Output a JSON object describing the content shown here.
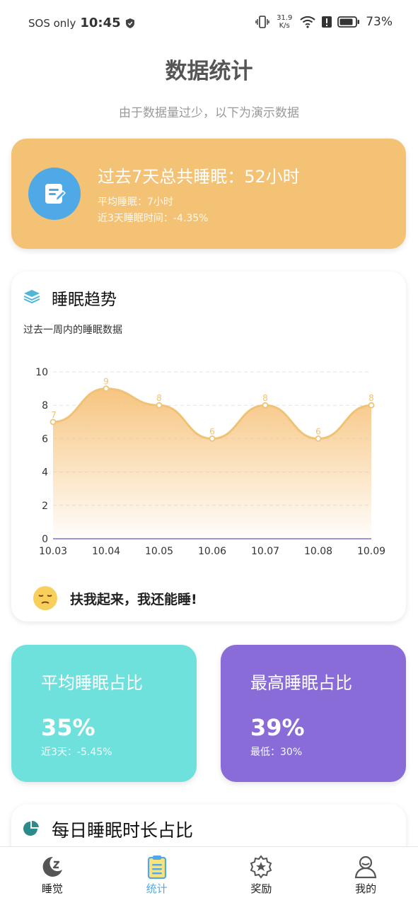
{
  "status_bar": {
    "carrier": "SOS only",
    "time": "10:45",
    "net_speed_value": "31.9",
    "net_speed_unit": "K/s",
    "battery": "73%"
  },
  "header": {
    "title": "数据统计",
    "subtitle": "由于数据量过少，以下为演示数据"
  },
  "summary": {
    "headline": "过去7天总共睡眠：52小时",
    "avg_line": "平均睡眠：7小时",
    "recent_line": "近3天睡眠时间：-4.35%",
    "accent_color": "#f4c274",
    "icon": "note-edit-icon"
  },
  "trend": {
    "title": "睡眠趋势",
    "description": "过去一周内的睡眠数据",
    "footer_text": "扶我起来，我还能睡!",
    "footer_icon": "sleepy-face-icon"
  },
  "chart_data": {
    "type": "area",
    "x": [
      "10.03",
      "10.04",
      "10.05",
      "10.06",
      "10.07",
      "10.08",
      "10.09"
    ],
    "series": [
      {
        "values": [
          7,
          9,
          8,
          6,
          8,
          6,
          8
        ]
      }
    ],
    "y_ticks": [
      "0",
      "2",
      "4",
      "6",
      "8",
      "10"
    ],
    "ylim": [
      0,
      10
    ],
    "grid": "horizontal dashed",
    "line_color": "#f0c275",
    "fill_color": "#f6c27a"
  },
  "ratio_cards": [
    {
      "title": "平均睡眠占比",
      "value": "35%",
      "sub": "近3天：-5.45%",
      "color": "#6fe1dc"
    },
    {
      "title": "最高睡眠占比",
      "value": "39%",
      "sub": "最低：30%",
      "color": "#8a6cd9"
    }
  ],
  "daily": {
    "title": "每日睡眠时长占比",
    "icon": "pie-chart-icon"
  },
  "bottom_nav": {
    "active_color": "#4fa9e6",
    "items": [
      {
        "label": "睡觉",
        "icon": "moon-sleep-icon"
      },
      {
        "label": "统计",
        "icon": "clipboard-list-icon"
      },
      {
        "label": "奖励",
        "icon": "medal-icon"
      },
      {
        "label": "我的",
        "icon": "user-icon"
      }
    ]
  }
}
